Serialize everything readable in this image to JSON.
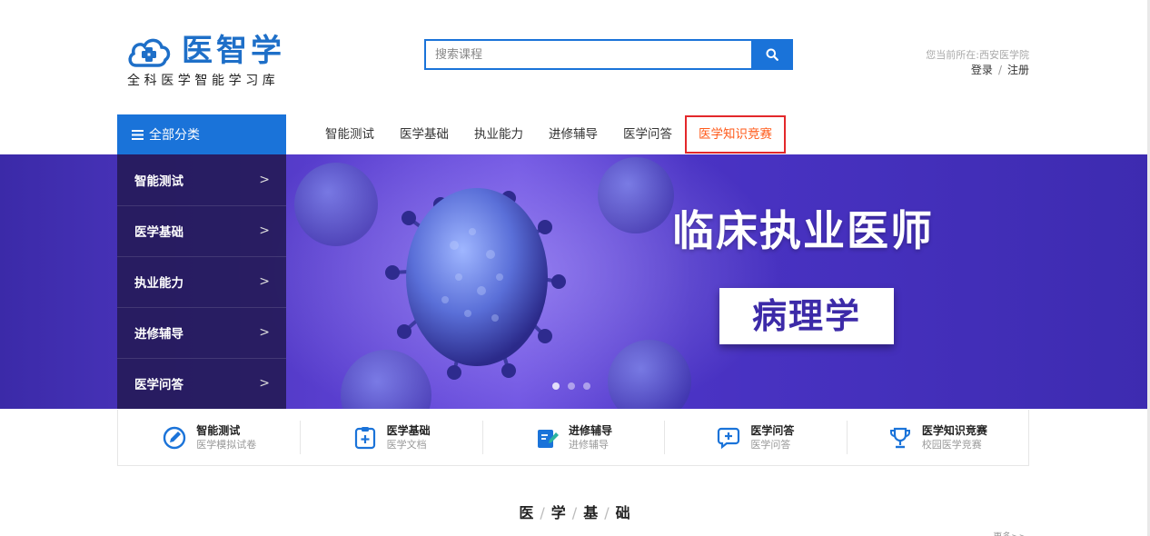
{
  "header": {
    "logo_title": "医智学",
    "logo_subtitle": "全科医学智能学习库",
    "search_placeholder": "搜索课程",
    "location_text": "您当前所在:西安医学院",
    "login": "登录",
    "separator": "/",
    "register": "注册"
  },
  "nav": {
    "all_categories": "全部分类",
    "items": [
      {
        "label": "智能测试"
      },
      {
        "label": "医学基础"
      },
      {
        "label": "执业能力"
      },
      {
        "label": "进修辅导"
      },
      {
        "label": "医学问答"
      },
      {
        "label": "医学知识竞赛",
        "active": true
      }
    ]
  },
  "side_menu": {
    "items": [
      {
        "label": "智能测试",
        "arrow": ">"
      },
      {
        "label": "医学基础",
        "arrow": ">"
      },
      {
        "label": "执业能力",
        "arrow": ">"
      },
      {
        "label": "进修辅导",
        "arrow": ">"
      },
      {
        "label": "医学问答",
        "arrow": ">"
      }
    ]
  },
  "banner": {
    "title": "临床执业医师",
    "subtitle": "病理学",
    "slide_count": 3,
    "active_slide": 1
  },
  "features": [
    {
      "title": "智能测试",
      "desc": "医学模拟试卷",
      "icon": "pencil-circle-icon"
    },
    {
      "title": "医学基础",
      "desc": "医学文档",
      "icon": "medical-document-icon"
    },
    {
      "title": "进修辅导",
      "desc": "进修辅导",
      "icon": "tutoring-book-icon"
    },
    {
      "title": "医学问答",
      "desc": "医学问答",
      "icon": "chat-question-icon"
    },
    {
      "title": "医学知识竞赛",
      "desc": "校园医学竞赛",
      "icon": "trophy-icon"
    }
  ],
  "section": {
    "chars": [
      "医",
      "学",
      "基",
      "础"
    ],
    "divider": "/",
    "more": "更多>>"
  },
  "colors": {
    "primary_blue": "#1a73d9",
    "active_nav": "#ff5a1a",
    "active_border": "#e3282b",
    "banner_purple": "#4a33c4",
    "side_menu_bg": "#261b5a"
  }
}
